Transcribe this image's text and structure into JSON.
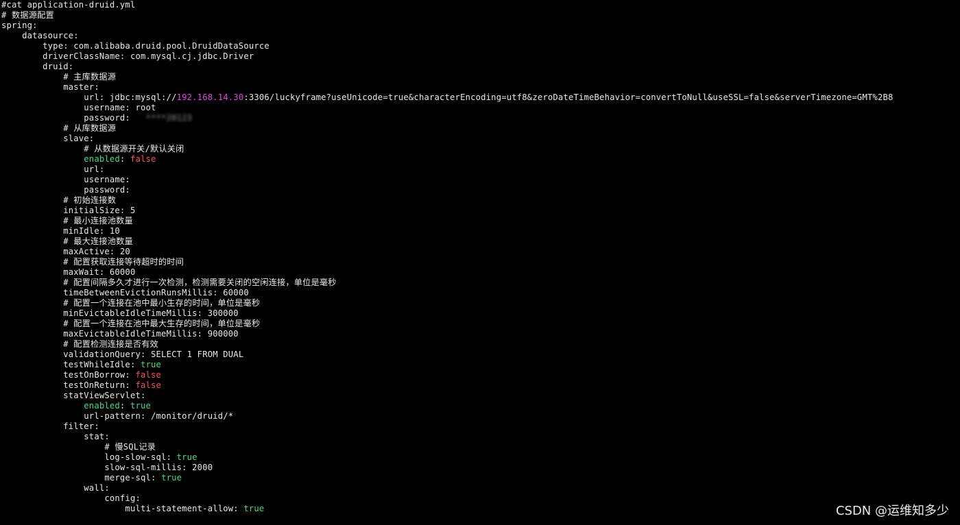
{
  "colors": {
    "background": "#000000",
    "text": "#e8e8e8",
    "boolean_true": "#36e07f",
    "boolean_false": "#ff4f4f",
    "ip_address": "#e83fe0",
    "key_green": "#36e07f"
  },
  "terminal": {
    "lines": [
      {
        "indent": 0,
        "segments": [
          {
            "text": "#cat application-druid.yml"
          }
        ]
      },
      {
        "indent": 0,
        "segments": [
          {
            "text": "# 数据源配置"
          }
        ]
      },
      {
        "indent": 0,
        "segments": [
          {
            "text": "spring:"
          }
        ]
      },
      {
        "indent": 4,
        "segments": [
          {
            "text": "datasource:"
          }
        ]
      },
      {
        "indent": 8,
        "segments": [
          {
            "text": "type: com.alibaba.druid.pool.DruidDataSource"
          }
        ]
      },
      {
        "indent": 8,
        "segments": [
          {
            "text": "driverClassName: com.mysql.cj.jdbc.Driver"
          }
        ]
      },
      {
        "indent": 8,
        "segments": [
          {
            "text": "druid:"
          }
        ]
      },
      {
        "indent": 12,
        "segments": [
          {
            "text": "# 主库数据源"
          }
        ]
      },
      {
        "indent": 12,
        "segments": [
          {
            "text": "master:"
          }
        ]
      },
      {
        "indent": 16,
        "segments": [
          {
            "text": "url: jdbc:mysql://"
          },
          {
            "text": "192.168.14.30",
            "style": "ip"
          },
          {
            "text": ":3306/luckyframe?useUnicode=true&characterEncoding=utf8&zeroDateTimeBehavior=convertToNull&useSSL=false&serverTimezone=GMT%2B8"
          }
        ]
      },
      {
        "indent": 16,
        "segments": [
          {
            "text": "username: root"
          }
        ]
      },
      {
        "indent": 16,
        "segments": [
          {
            "text": "password: "
          },
          {
            "text": "  ****20123",
            "style": "redacted"
          }
        ]
      },
      {
        "indent": 12,
        "segments": [
          {
            "text": "# 从库数据源"
          }
        ]
      },
      {
        "indent": 12,
        "segments": [
          {
            "text": "slave:"
          }
        ]
      },
      {
        "indent": 16,
        "segments": [
          {
            "text": "# 从数据源开关/默认关闭"
          }
        ]
      },
      {
        "indent": 16,
        "segments": [
          {
            "text": "enabled",
            "style": "key"
          },
          {
            "text": ": "
          },
          {
            "text": "false",
            "style": "false"
          }
        ]
      },
      {
        "indent": 16,
        "segments": [
          {
            "text": "url:"
          }
        ]
      },
      {
        "indent": 16,
        "segments": [
          {
            "text": "username:"
          }
        ]
      },
      {
        "indent": 16,
        "segments": [
          {
            "text": "password:"
          }
        ]
      },
      {
        "indent": 12,
        "segments": [
          {
            "text": "# 初始连接数"
          }
        ]
      },
      {
        "indent": 12,
        "segments": [
          {
            "text": "initialSize: 5"
          }
        ]
      },
      {
        "indent": 12,
        "segments": [
          {
            "text": "# 最小连接池数量"
          }
        ]
      },
      {
        "indent": 12,
        "segments": [
          {
            "text": "minIdle: 10"
          }
        ]
      },
      {
        "indent": 12,
        "segments": [
          {
            "text": "# 最大连接池数量"
          }
        ]
      },
      {
        "indent": 12,
        "segments": [
          {
            "text": "maxActive: 20"
          }
        ]
      },
      {
        "indent": 12,
        "segments": [
          {
            "text": "# 配置获取连接等待超时的时间"
          }
        ]
      },
      {
        "indent": 12,
        "segments": [
          {
            "text": "maxWait: 60000"
          }
        ]
      },
      {
        "indent": 12,
        "segments": [
          {
            "text": "# 配置间隔多久才进行一次检测，检测需要关闭的空闲连接，单位是毫秒"
          }
        ]
      },
      {
        "indent": 12,
        "segments": [
          {
            "text": "timeBetweenEvictionRunsMillis: 60000"
          }
        ]
      },
      {
        "indent": 12,
        "segments": [
          {
            "text": "# 配置一个连接在池中最小生存的时间，单位是毫秒"
          }
        ]
      },
      {
        "indent": 12,
        "segments": [
          {
            "text": "minEvictableIdleTimeMillis: 300000"
          }
        ]
      },
      {
        "indent": 12,
        "segments": [
          {
            "text": "# 配置一个连接在池中最大生存的时间，单位是毫秒"
          }
        ]
      },
      {
        "indent": 12,
        "segments": [
          {
            "text": "maxEvictableIdleTimeMillis: 900000"
          }
        ]
      },
      {
        "indent": 12,
        "segments": [
          {
            "text": "# 配置检测连接是否有效"
          }
        ]
      },
      {
        "indent": 12,
        "segments": [
          {
            "text": "validationQuery: SELECT 1 FROM DUAL"
          }
        ]
      },
      {
        "indent": 12,
        "segments": [
          {
            "text": "testWhileIdle: "
          },
          {
            "text": "true",
            "style": "true"
          }
        ]
      },
      {
        "indent": 12,
        "segments": [
          {
            "text": "testOnBorrow: "
          },
          {
            "text": "false",
            "style": "false"
          }
        ]
      },
      {
        "indent": 12,
        "segments": [
          {
            "text": "testOnReturn: "
          },
          {
            "text": "false",
            "style": "false"
          }
        ]
      },
      {
        "indent": 12,
        "segments": [
          {
            "text": "statViewServlet:"
          }
        ]
      },
      {
        "indent": 16,
        "segments": [
          {
            "text": "enabled",
            "style": "key"
          },
          {
            "text": ": "
          },
          {
            "text": "true",
            "style": "true"
          }
        ]
      },
      {
        "indent": 16,
        "segments": [
          {
            "text": "url-pattern: /monitor/druid/*"
          }
        ]
      },
      {
        "indent": 12,
        "segments": [
          {
            "text": "filter:"
          }
        ]
      },
      {
        "indent": 16,
        "segments": [
          {
            "text": "stat:"
          }
        ]
      },
      {
        "indent": 20,
        "segments": [
          {
            "text": "# 慢SQL记录"
          }
        ]
      },
      {
        "indent": 20,
        "segments": [
          {
            "text": "log-slow-sql: "
          },
          {
            "text": "true",
            "style": "true"
          }
        ]
      },
      {
        "indent": 20,
        "segments": [
          {
            "text": "slow-sql-millis: 2000"
          }
        ]
      },
      {
        "indent": 20,
        "segments": [
          {
            "text": "merge-sql: "
          },
          {
            "text": "true",
            "style": "true"
          }
        ]
      },
      {
        "indent": 16,
        "segments": [
          {
            "text": "wall:"
          }
        ]
      },
      {
        "indent": 20,
        "segments": [
          {
            "text": "config:"
          }
        ]
      },
      {
        "indent": 24,
        "segments": [
          {
            "text": "multi-statement-allow: "
          },
          {
            "text": "true",
            "style": "true"
          }
        ]
      }
    ]
  },
  "watermark": {
    "text": "CSDN @运维知多少"
  }
}
